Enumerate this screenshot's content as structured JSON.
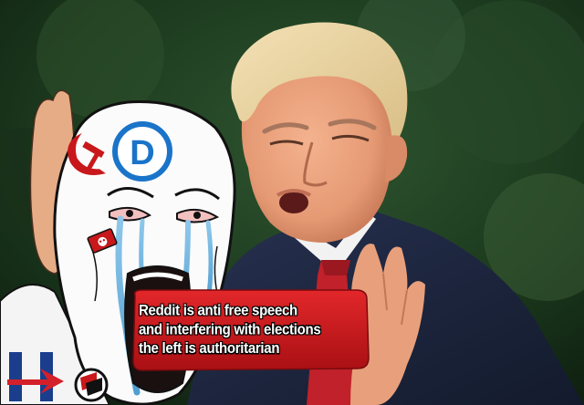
{
  "meme": {
    "caption_lines": [
      "Reddit is anti free speech",
      "and interfering with elections",
      "the left is authoritarian"
    ],
    "emblems": {
      "dnc_letter": "D",
      "hillary_letter": "H"
    },
    "icons": [
      "hammer-sickle-icon",
      "dnc-logo-icon",
      "reddit-mod-badge-icon",
      "hillary-h-logo-icon",
      "antifa-flag-icon"
    ],
    "colors": {
      "background": "#1c3a1e",
      "caption_box": "#c8181b",
      "dnc_blue": "#1a74c9",
      "tie_red": "#c0212a",
      "suit_navy": "#1a2238"
    }
  }
}
